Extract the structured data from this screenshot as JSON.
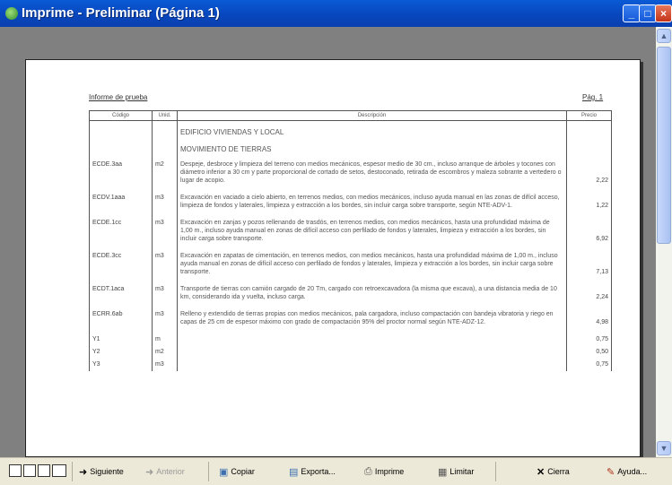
{
  "window": {
    "title": "Imprime - Preliminar (Página 1)"
  },
  "report": {
    "title": "Informe de prueba",
    "page": "Pág. 1",
    "columns": [
      "Código",
      "Unid.",
      "Descripción",
      "Precio"
    ],
    "section1": "EDIFICIO VIVIENDAS Y LOCAL",
    "section2": "MOVIMIENTO DE TIERRAS",
    "rows": [
      {
        "code": "ECDE.3aa",
        "unit": "m2",
        "desc": "Despeje, desbroce y limpieza del terreno con medios mecánicos, espesor medio de 30 cm., incluso arranque de árboles y tocones con diámetro inferior a 30 cm y parte proporcional de cortado de setos, destoconado, retirada de escombros y maleza sobrante a vertedero o lugar de acopio.",
        "price": "2,22"
      },
      {
        "code": "ECDV.1aaa",
        "unit": "m3",
        "desc": "Excavación en vaciado a cielo abierto, en terrenos medios, con medios mecánicos, incluso ayuda manual en las zonas de difícil acceso, limpieza de fondos y laterales, limpieza y extracción a los bordes, sin incluir carga sobre transporte, según NTE-ADV-1.",
        "price": "1,22"
      },
      {
        "code": "ECDE.1cc",
        "unit": "m3",
        "desc": "Excavación en zanjas y pozos rellenando de trasdós, en terrenos medios, con medios mecánicos, hasta una profundidad máxima de 1,00 m., incluso ayuda manual en zonas de difícil acceso con perfilado de fondos y laterales, limpieza y extracción a los bordes, sin incluir carga sobre transporte.",
        "price": "6,92"
      },
      {
        "code": "ECDE.3cc",
        "unit": "m3",
        "desc": "Excavación en zapatas de cimentación, en terrenos medios, con medios mecánicos, hasta una profundidad máxima de 1,00 m., incluso ayuda manual en zonas de difícil acceso con perfilado de fondos y laterales, limpieza y extracción a los bordes, sin incluir carga sobre transporte.",
        "price": "7,13"
      },
      {
        "code": "ECDT.1aca",
        "unit": "m3",
        "desc": "Transporte de tierras con camión cargado de 20 Tm, cargado con retroexcavadora (la misma que excava), a una distancia media de 10 km, considerando ida y vuelta, incluso carga.",
        "price": "2,24"
      },
      {
        "code": "ECRR.6ab",
        "unit": "m3",
        "desc": "Relleno y extendido de tierras propias con medios mecánicos, pala cargadora, incluso compactación con bandeja vibratoria y riego en capas de 25 cm de espesor máximo con grado de compactación 95% del proctor normal según NTE-ADZ-12.",
        "price": "4,98"
      },
      {
        "code": "Y1",
        "unit": "m",
        "desc": "",
        "price": "0,75"
      },
      {
        "code": "Y2",
        "unit": "m2",
        "desc": "",
        "price": "0,50"
      },
      {
        "code": "Y3",
        "unit": "m3",
        "desc": "",
        "price": "0,75"
      }
    ]
  },
  "toolbar": {
    "next": "Siguiente",
    "previous": "Anterior",
    "copy": "Copiar",
    "export": "Exporta...",
    "print": "Imprime",
    "clear": "Limitar",
    "close": "Cierra",
    "help": "Ayuda..."
  },
  "colors": {
    "titlebar": "#0a5bd6",
    "background": "#808080"
  }
}
